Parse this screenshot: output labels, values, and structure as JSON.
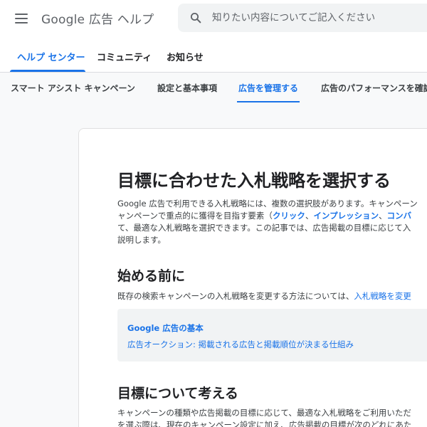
{
  "header": {
    "product_brand": "Google",
    "product_name": "広告 ヘルプ",
    "search_placeholder": "知りたい内容についてご記入ください"
  },
  "tabs": [
    {
      "label": "ヘルプ センター",
      "active": true
    },
    {
      "label": "コミュニティ",
      "active": false
    },
    {
      "label": "お知らせ",
      "active": false
    }
  ],
  "subnav": [
    {
      "label": "スマート アシスト キャンペーン",
      "active": false
    },
    {
      "label": "設定と基本事項",
      "active": false
    },
    {
      "label": "広告を管理する",
      "active": true
    },
    {
      "label": "広告のパフォーマンスを確認",
      "active": false
    }
  ],
  "article": {
    "title": "目標に合わせた入札戦略を選択する",
    "intro": {
      "line1": "Google 広告で利用できる入札戦略には、複数の選択肢があります。キャンペーン",
      "line2_prefix": "ャンペーンで重点的に獲得を目指す要素（",
      "kw_click": "クリック",
      "sep1": "、",
      "kw_impression": "インプレッション",
      "sep2": "、",
      "kw_conversion": "コンバ",
      "line3": "て、最適な入札戦略を選択できます。この記事では、広告掲載の目標に応じて入",
      "line4": "説明します。"
    },
    "section1": {
      "heading": "始める前に",
      "text": "既存の検索キャンペーンの入札戦略を変更する方法については、",
      "link": "入札戦略を変更"
    },
    "callout": {
      "title": "Google 広告の基本",
      "link": "広告オークション: 掲載される広告と掲載順位が決まる仕組み"
    },
    "section2": {
      "heading": "目標について考える",
      "line1": "キャンペーンの種類や広告掲載の目標に応じて、最適な入札戦略をご利用いただ",
      "line2": "を選ぶ際は、現在のキャンペーン設定に加え、広告掲載の目標が次のどれにあた"
    }
  },
  "colors": {
    "accent": "#1a73e8",
    "text": "#202124",
    "muted": "#5f6368",
    "surface": "#f8f9fa"
  }
}
